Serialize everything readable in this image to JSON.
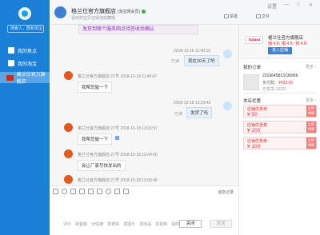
{
  "sidebar": {
    "search_placeholder": "搜索人、群和淘宝",
    "items": [
      {
        "label": "我的焦点"
      },
      {
        "label": "我的淘宝"
      },
      {
        "label": "格兰仕官方旗舰店"
      }
    ]
  },
  "header": {
    "shop_name": "格兰仕官方旗舰店",
    "shop_tag": "[淘宝网会员]",
    "subtitle": "喜欢的宝贝记得加收藏哦",
    "tools": [
      "举报",
      "文件"
    ],
    "window_controls": [
      "设置",
      "—",
      "□",
      "✕"
    ]
  },
  "chat": {
    "banner": "发货到哪个服务网点待签收后确认",
    "messages": [
      {
        "meta": "2018-10-18 11:40:10",
        "text": "现在20天了吧",
        "status": "已读"
      },
      {
        "meta": "格兰仕官方旗舰店:27号  2018-10-18 11:40:47",
        "text": "我帮您催一下"
      },
      {
        "meta": "2018-10-18 13:03:42",
        "text": "发货了吗",
        "status": "已读"
      },
      {
        "meta": "格兰仕官方旗舰店:27号  2018-10-18 13:03:57",
        "text": "我帮您催一下"
      },
      {
        "meta": "格兰仕官方旗舰店:27号  2018-10-18 13:04:00",
        "text": "会让厂家尽快发出的"
      },
      {
        "meta": "格兰仕官方旗舰店:27号  2018-10-18 13:09:48",
        "text": ""
      }
    ]
  },
  "input": {
    "history": "消息记录",
    "quick_phrases": [
      "评价",
      "找客服",
      "对快捷",
      "发表情",
      "发图片",
      "发商品",
      "发视频",
      "拍照"
    ],
    "close_label": "关闭",
    "send_label": "发送"
  },
  "right_panel": {
    "brand_logo_text": "Galanz 格兰仕",
    "shop_name": "格兰仕官方旗舰店",
    "rating": "描 4.8↑ 服 4.8↑ 物 4.8↑",
    "enter_shop": "进入店铺",
    "orders_title": "我的订单",
    "more": "更多 ›",
    "order_id": "2216645813136966",
    "order_paid_label": "实付款：",
    "order_paid_value": "¥430.00",
    "order_status": "已发货·12/20",
    "coupons_title": "本店优惠",
    "coupons": [
      {
        "title": "店铺优惠券",
        "amount": "¥ 50",
        "button": "立即领取"
      },
      {
        "title": "店铺优惠券",
        "amount": "¥ 200",
        "button": "立即领取"
      },
      {
        "title": "店铺优惠券",
        "amount": "¥ 100",
        "button": "立即领取"
      }
    ]
  },
  "colors": {
    "sidebar": "#1a7fd6",
    "accent": "#3c85d6",
    "price": "#e4393c"
  }
}
